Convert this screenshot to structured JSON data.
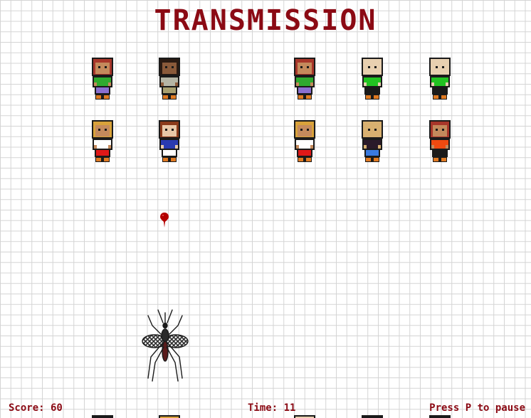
{
  "game": {
    "title": "TRANSMISSION",
    "score_text": "Score: 60",
    "time_text": "Time: 11",
    "pause_hint": "Press P to pause"
  },
  "colors": {
    "title": "#8b0a14",
    "grid": "#d4d4d4",
    "outline": "#1a1a1a",
    "blood": "#b30000"
  },
  "people": [
    {
      "hair": "#a8362a",
      "skin": "#c48a5c",
      "shirt": "#2faa2f",
      "pants": "#8a6fd0",
      "shoes": "#e07a22"
    },
    {
      "hair": "#2a1a12",
      "skin": "#8a5a3a",
      "shirt": "#b5b5a5",
      "pants": "#a8a070",
      "shoes": "#e07a22"
    },
    {
      "hair": "#a8362a",
      "skin": "#c48a5c",
      "shirt": "#2faa2f",
      "pants": "#8a6fd0",
      "shoes": "#e07a22"
    },
    {
      "hair": "#e8d0b0",
      "skin": "#e8d0b0",
      "shirt": "#22c322",
      "pants": "#1a1a1a",
      "shoes": "#e07a22"
    },
    {
      "hair": "#e8d0b0",
      "skin": "#e8d0b0",
      "shirt": "#22c322",
      "pants": "#1a1a1a",
      "shoes": "#e07a22"
    },
    {
      "hair": "#d9a23a",
      "skin": "#c48a5c",
      "shirt": "#ffffff",
      "pants": "#e01818",
      "shoes": "#e07a22"
    },
    {
      "hair": "#8a3a1a",
      "skin": "#e8c8a8",
      "shirt": "#2a3ab0",
      "pants": "#ffffff",
      "shoes": "#e07a22"
    },
    {
      "hair": "#d9a23a",
      "skin": "#c48a5c",
      "shirt": "#ffffff",
      "pants": "#e01818",
      "shoes": "#e07a22"
    },
    {
      "hair": "#d8b070",
      "skin": "#d8b070",
      "shirt": "#2a1a2a",
      "pants": "#3a7ae0",
      "shoes": "#e07a22"
    },
    {
      "hair": "#a8362a",
      "skin": "#c48a5c",
      "shirt": "#f04a10",
      "pants": "#1a1a1a",
      "shoes": "#e07a22"
    }
  ],
  "partial_people": [
    {
      "hair": "#1a1a1a"
    },
    {
      "hair": "#d9a23a"
    },
    {
      "hair": "#e8d0b0"
    },
    {
      "hair": "#1a1a1a"
    },
    {
      "hair": "#1a1a1a"
    }
  ]
}
